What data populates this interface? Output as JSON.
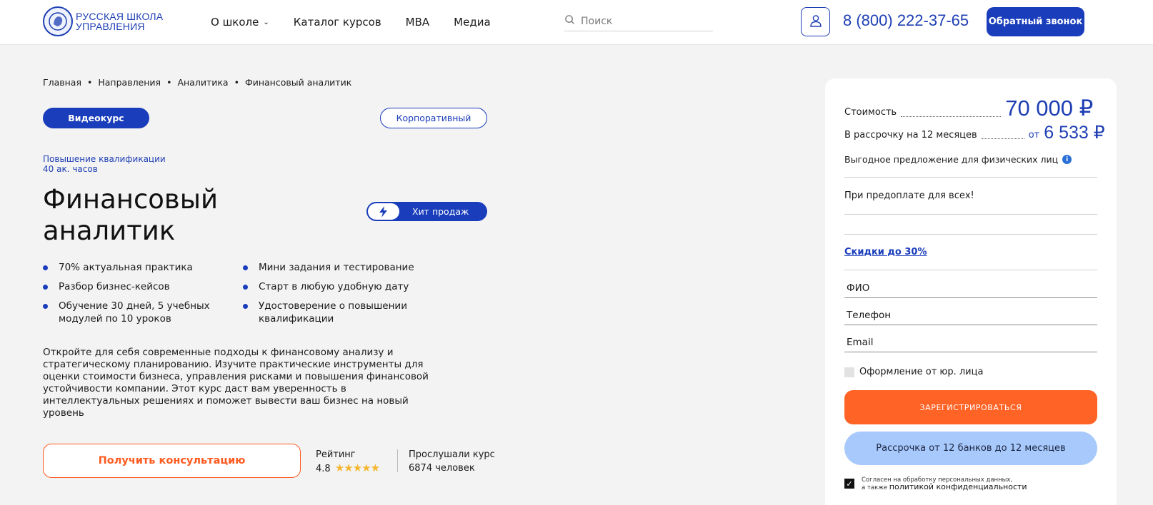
{
  "header": {
    "logo_line1": "РУССКАЯ ШКОЛА",
    "logo_line2": "УПРАВЛЕНИЯ",
    "nav": [
      {
        "label": "О школе"
      },
      {
        "label": "Каталог курсов"
      },
      {
        "label": "MBA"
      },
      {
        "label": "Медиа"
      }
    ],
    "search_placeholder": "Поиск",
    "phone": "8 (800) 222-37-65",
    "callback_label": "Обратный звонок"
  },
  "breadcrumb": [
    "Главная",
    "Направления",
    "Аналитика",
    "Финансовый аналитик"
  ],
  "tags": {
    "video": "Видеокурс",
    "corporate": "Корпоративный"
  },
  "qualification": {
    "type": "Повышение квалификации",
    "hours": "40 ак. часов"
  },
  "course": {
    "title_line1": "Финансовый",
    "title_line2": "аналитик",
    "badge": "Хит продаж",
    "features_col1": [
      "70% актуальная практика",
      "Разбор бизнес-кейсов",
      "Обучение 30 дней, 5 учебных модулей по 10 уроков"
    ],
    "features_col2": [
      "Мини задания и тестирование",
      "Старт в любую удобную дату",
      "Удостоверение о повышении квалификации"
    ],
    "description": "Откройте для себя современные подходы к финансовому анализу и стратегическому планированию. Изучите практические инструменты для оценки стоимости бизнеса, управления рисками и повышения финансовой устойчивости компании. Этот курс даст вам уверенность в интеллектуальных решениях и поможет вывести ваш бизнес на новый уровень",
    "consult_label": "Получить консультацию",
    "rating_label": "Рейтинг",
    "rating_value": "4.8",
    "rating_stars": "★★★★★",
    "listened_label": "Прослушали курс",
    "listened_value": "6874 человек"
  },
  "card": {
    "cost_label": "Стоимость",
    "cost_value": "70 000 ₽",
    "installment_label": "В рассрочку на 12 месяцев",
    "installment_from": "от",
    "installment_value": "6 533 ₽",
    "offer": "Выгодное предложение для физических лиц",
    "prepay": "При предоплате для всех!",
    "discount": "Скидки до 30%",
    "fields": {
      "name": "ФИО",
      "phone": "Телефон",
      "email": "Email"
    },
    "legal_entity": "Оформление от юр. лица",
    "register_label": "ЗАРЕГИСТРИРОВАТЬСЯ",
    "installment_btn": "Рассрочка от 12 банков до 12 месяцев",
    "consent_line1": "Согласен на обработку персональных данных,",
    "consent_line2": "а также",
    "consent_link": "политикой конфиденциальности"
  },
  "colors": {
    "brand": "#1a3dbb",
    "accent": "#ff6326",
    "installment": "#a8c9fb"
  }
}
